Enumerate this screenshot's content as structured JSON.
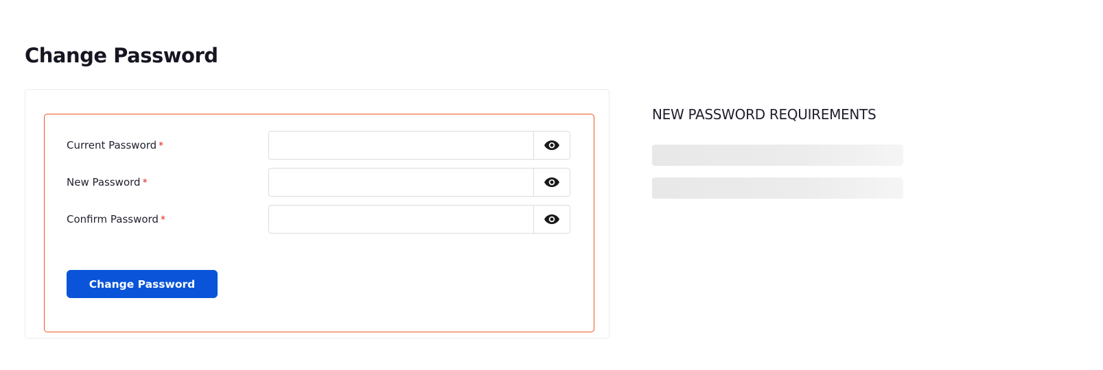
{
  "page": {
    "title": "Change Password"
  },
  "form": {
    "fields": [
      {
        "label": "Current Password",
        "required_mark": "*",
        "value": "",
        "placeholder": "",
        "toggle_icon": "eye-icon"
      },
      {
        "label": "New Password",
        "required_mark": "*",
        "value": "",
        "placeholder": "",
        "toggle_icon": "eye-icon"
      },
      {
        "label": "Confirm Password",
        "required_mark": "*",
        "value": "",
        "placeholder": "",
        "toggle_icon": "eye-icon"
      }
    ],
    "submit_label": "Change Password"
  },
  "requirements": {
    "title": "NEW PASSWORD REQUIREMENTS",
    "loading_placeholders": 2
  },
  "colors": {
    "primary_button": "#0954d8",
    "form_border_accent": "#e8541e",
    "required_star": "#e0201d",
    "title_text": "#161622"
  }
}
